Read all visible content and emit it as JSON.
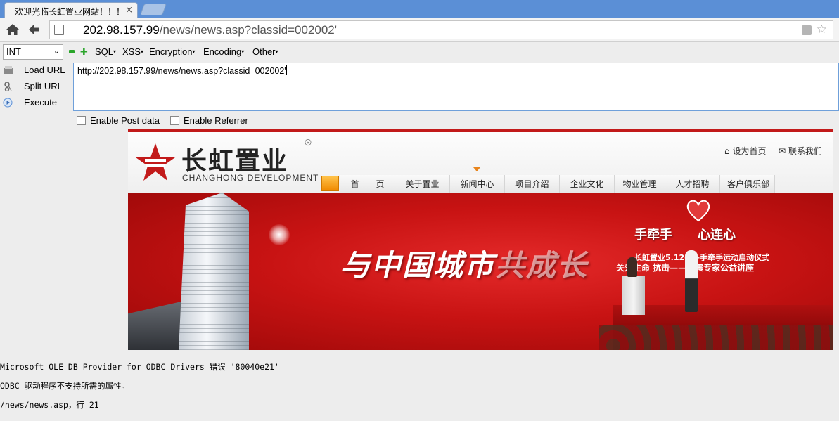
{
  "tab": {
    "title": "欢迎光临长虹置业网站！！！",
    "close": "×"
  },
  "address": {
    "host": "202.98.157.99",
    "path": "/news/news.asp?classid=002002'"
  },
  "hackbar": {
    "type_select": "INT",
    "menus": [
      "SQL",
      "XSS",
      "Encryption",
      "Encoding",
      "Other"
    ],
    "load_url": "Load URL",
    "split_url": "Split URL",
    "execute": "Execute",
    "url_value": "http://202.98.157.99/news/news.asp?classid=002002'",
    "enable_post": "Enable Post data",
    "enable_referrer": "Enable Referrer"
  },
  "site": {
    "logo_cn": "长虹置业",
    "logo_en": "CHANGHONG DEVELOPMENT",
    "logo_reg": "®",
    "set_home": "设为首页",
    "contact": "联系我们",
    "nav": [
      "首　　页",
      "关于置业",
      "新闻中心",
      "项目介绍",
      "企业文化",
      "物业管理",
      "人才招聘",
      "客户俱乐部"
    ],
    "banner": {
      "slogan_a": "与中国城市",
      "slogan_b": "共成长",
      "event_title_a": "手牵手",
      "event_title_b": "心连心",
      "event_line1": "长虹置业5.12——手牵手运动启动仪式",
      "event_line2": "关爱生命 抗击——抗震专家公益讲座"
    }
  },
  "error": {
    "line1": "Microsoft OLE DB Provider for ODBC Drivers 错误 '80040e21'",
    "line2": "ODBC 驱动程序不支持所需的属性。",
    "line3": "/news/news.asp，行 21"
  },
  "colors": {
    "tabstrip": "#5b8fd6",
    "site_red": "#c21a1a",
    "nav_orange": "#f08a00"
  }
}
